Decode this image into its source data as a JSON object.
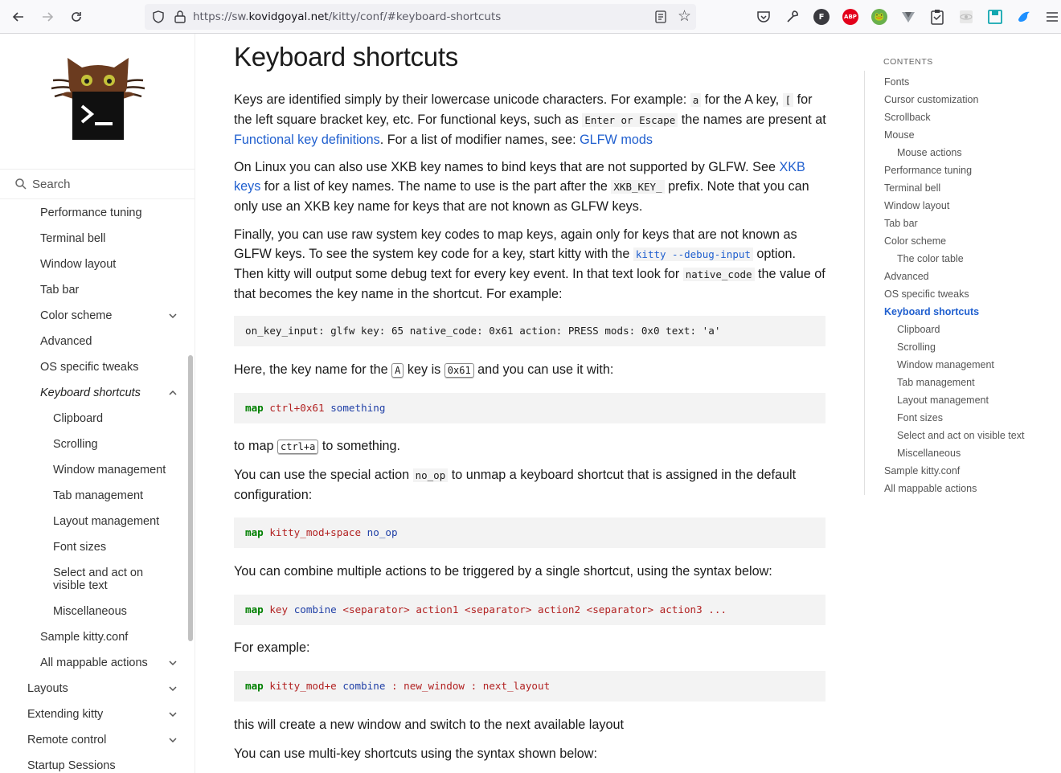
{
  "browser": {
    "url_prefix": "https://sw.",
    "url_domain": "kovidgoyal.net",
    "url_suffix": "/kitty/conf/#keyboard-shortcuts",
    "ext_f": "F",
    "ext_abp": "ABP"
  },
  "sidebar": {
    "search_placeholder": "Search",
    "items": [
      {
        "label": "Performance tuning"
      },
      {
        "label": "Terminal bell"
      },
      {
        "label": "Window layout"
      },
      {
        "label": "Tab bar"
      },
      {
        "label": "Color scheme"
      },
      {
        "label": "Advanced"
      },
      {
        "label": "OS specific tweaks"
      },
      {
        "label": "Keyboard shortcuts"
      },
      {
        "label": "Clipboard"
      },
      {
        "label": "Scrolling"
      },
      {
        "label": "Window management"
      },
      {
        "label": "Tab management"
      },
      {
        "label": "Layout management"
      },
      {
        "label": "Font sizes"
      },
      {
        "label": "Select and act on visible text"
      },
      {
        "label": "Miscellaneous"
      },
      {
        "label": "Sample kitty.conf"
      },
      {
        "label": "All mappable actions"
      },
      {
        "label": "Layouts"
      },
      {
        "label": "Extending kitty"
      },
      {
        "label": "Remote control"
      },
      {
        "label": "Startup Sessions"
      }
    ]
  },
  "main": {
    "title": "Keyboard shortcuts",
    "p1": {
      "t1": "Keys are identified simply by their lowercase unicode characters. For example: ",
      "c1": "a",
      "t2": " for the A key, ",
      "c2": "[",
      "t3": " for the left square bracket key, etc. For functional keys, such as ",
      "c3": "Enter or Escape",
      "t4": " the names are present at ",
      "l1": "Functional key definitions",
      "t5": ". For a list of modifier names, see: ",
      "l2": "GLFW mods"
    },
    "p2": {
      "t1": "On Linux you can also use XKB key names to bind keys that are not supported by GLFW. See ",
      "l1": "XKB keys",
      "t2": " for a list of key names. The name to use is the part after the ",
      "c1": "XKB_KEY_",
      "t3": " prefix. Note that you can only use an XKB key name for keys that are not known as GLFW keys."
    },
    "p3": {
      "t1": "Finally, you can use raw system key codes to map keys, again only for keys that are not known as GLFW keys. To see the system key code for a key, start kitty with the ",
      "c1": "kitty --debug-input",
      "t2": " option. Then kitty will output some debug text for every key event. In that text look for ",
      "c2": "native_code",
      "t3": " the value of that becomes the key name in the shortcut. For example:"
    },
    "code1": "on_key_input: glfw key: 65 native_code: 0x61 action: PRESS mods: 0x0 text: 'a'",
    "p4": {
      "t1": "Here, the key name for the ",
      "k1": "A",
      "t2": " key is ",
      "k2": "0x61",
      "t3": " and you can use it with:"
    },
    "code2": {
      "map": "map",
      "a": "ctrl+0x61",
      "b": "something"
    },
    "p5": {
      "t1": "to map ",
      "k1": "ctrl+a",
      "t2": " to something."
    },
    "p6": {
      "t1": "You can use the special action ",
      "c1": "no_op",
      "t2": " to unmap a keyboard shortcut that is assigned in the default configuration:"
    },
    "code3": {
      "map": "map",
      "a": "kitty_mod+space",
      "b": "no_op"
    },
    "p7": "You can combine multiple actions to be triggered by a single shortcut, using the syntax below:",
    "code4": {
      "map": "map",
      "a": "key",
      "b": "combine",
      "c": "<separator> action1 <separator> action2 <separator> action3 ..."
    },
    "p8": "For example:",
    "code5": {
      "map": "map",
      "a": "kitty_mod+e",
      "b": "combine",
      "c": ": new_window : next_layout"
    },
    "p9": "this will create a new window and switch to the next available layout",
    "p10": "You can use multi-key shortcuts using the syntax shown below:"
  },
  "toc": {
    "title": "CONTENTS",
    "items": [
      {
        "label": "Fonts"
      },
      {
        "label": "Cursor customization"
      },
      {
        "label": "Scrollback"
      },
      {
        "label": "Mouse"
      },
      {
        "label": "Mouse actions"
      },
      {
        "label": "Performance tuning"
      },
      {
        "label": "Terminal bell"
      },
      {
        "label": "Window layout"
      },
      {
        "label": "Tab bar"
      },
      {
        "label": "Color scheme"
      },
      {
        "label": "The color table"
      },
      {
        "label": "Advanced"
      },
      {
        "label": "OS specific tweaks"
      },
      {
        "label": "Keyboard shortcuts"
      },
      {
        "label": "Clipboard"
      },
      {
        "label": "Scrolling"
      },
      {
        "label": "Window management"
      },
      {
        "label": "Tab management"
      },
      {
        "label": "Layout management"
      },
      {
        "label": "Font sizes"
      },
      {
        "label": "Select and act on visible text"
      },
      {
        "label": "Miscellaneous"
      },
      {
        "label": "Sample kitty.conf"
      },
      {
        "label": "All mappable actions"
      }
    ]
  }
}
